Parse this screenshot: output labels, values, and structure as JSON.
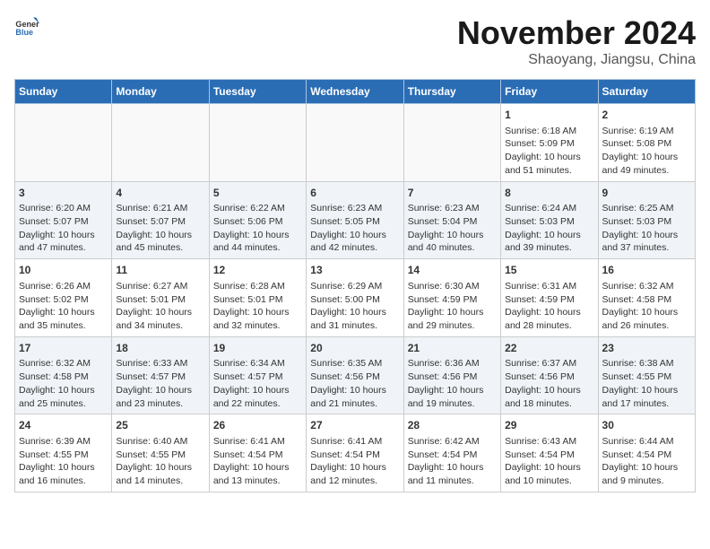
{
  "logo": {
    "line1": "General",
    "line2": "Blue"
  },
  "title": "November 2024",
  "subtitle": "Shaoyang, Jiangsu, China",
  "days_of_week": [
    "Sunday",
    "Monday",
    "Tuesday",
    "Wednesday",
    "Thursday",
    "Friday",
    "Saturday"
  ],
  "weeks": [
    [
      {
        "day": "",
        "info": ""
      },
      {
        "day": "",
        "info": ""
      },
      {
        "day": "",
        "info": ""
      },
      {
        "day": "",
        "info": ""
      },
      {
        "day": "",
        "info": ""
      },
      {
        "day": "1",
        "info": "Sunrise: 6:18 AM\nSunset: 5:09 PM\nDaylight: 10 hours and 51 minutes."
      },
      {
        "day": "2",
        "info": "Sunrise: 6:19 AM\nSunset: 5:08 PM\nDaylight: 10 hours and 49 minutes."
      }
    ],
    [
      {
        "day": "3",
        "info": "Sunrise: 6:20 AM\nSunset: 5:07 PM\nDaylight: 10 hours and 47 minutes."
      },
      {
        "day": "4",
        "info": "Sunrise: 6:21 AM\nSunset: 5:07 PM\nDaylight: 10 hours and 45 minutes."
      },
      {
        "day": "5",
        "info": "Sunrise: 6:22 AM\nSunset: 5:06 PM\nDaylight: 10 hours and 44 minutes."
      },
      {
        "day": "6",
        "info": "Sunrise: 6:23 AM\nSunset: 5:05 PM\nDaylight: 10 hours and 42 minutes."
      },
      {
        "day": "7",
        "info": "Sunrise: 6:23 AM\nSunset: 5:04 PM\nDaylight: 10 hours and 40 minutes."
      },
      {
        "day": "8",
        "info": "Sunrise: 6:24 AM\nSunset: 5:03 PM\nDaylight: 10 hours and 39 minutes."
      },
      {
        "day": "9",
        "info": "Sunrise: 6:25 AM\nSunset: 5:03 PM\nDaylight: 10 hours and 37 minutes."
      }
    ],
    [
      {
        "day": "10",
        "info": "Sunrise: 6:26 AM\nSunset: 5:02 PM\nDaylight: 10 hours and 35 minutes."
      },
      {
        "day": "11",
        "info": "Sunrise: 6:27 AM\nSunset: 5:01 PM\nDaylight: 10 hours and 34 minutes."
      },
      {
        "day": "12",
        "info": "Sunrise: 6:28 AM\nSunset: 5:01 PM\nDaylight: 10 hours and 32 minutes."
      },
      {
        "day": "13",
        "info": "Sunrise: 6:29 AM\nSunset: 5:00 PM\nDaylight: 10 hours and 31 minutes."
      },
      {
        "day": "14",
        "info": "Sunrise: 6:30 AM\nSunset: 4:59 PM\nDaylight: 10 hours and 29 minutes."
      },
      {
        "day": "15",
        "info": "Sunrise: 6:31 AM\nSunset: 4:59 PM\nDaylight: 10 hours and 28 minutes."
      },
      {
        "day": "16",
        "info": "Sunrise: 6:32 AM\nSunset: 4:58 PM\nDaylight: 10 hours and 26 minutes."
      }
    ],
    [
      {
        "day": "17",
        "info": "Sunrise: 6:32 AM\nSunset: 4:58 PM\nDaylight: 10 hours and 25 minutes."
      },
      {
        "day": "18",
        "info": "Sunrise: 6:33 AM\nSunset: 4:57 PM\nDaylight: 10 hours and 23 minutes."
      },
      {
        "day": "19",
        "info": "Sunrise: 6:34 AM\nSunset: 4:57 PM\nDaylight: 10 hours and 22 minutes."
      },
      {
        "day": "20",
        "info": "Sunrise: 6:35 AM\nSunset: 4:56 PM\nDaylight: 10 hours and 21 minutes."
      },
      {
        "day": "21",
        "info": "Sunrise: 6:36 AM\nSunset: 4:56 PM\nDaylight: 10 hours and 19 minutes."
      },
      {
        "day": "22",
        "info": "Sunrise: 6:37 AM\nSunset: 4:56 PM\nDaylight: 10 hours and 18 minutes."
      },
      {
        "day": "23",
        "info": "Sunrise: 6:38 AM\nSunset: 4:55 PM\nDaylight: 10 hours and 17 minutes."
      }
    ],
    [
      {
        "day": "24",
        "info": "Sunrise: 6:39 AM\nSunset: 4:55 PM\nDaylight: 10 hours and 16 minutes."
      },
      {
        "day": "25",
        "info": "Sunrise: 6:40 AM\nSunset: 4:55 PM\nDaylight: 10 hours and 14 minutes."
      },
      {
        "day": "26",
        "info": "Sunrise: 6:41 AM\nSunset: 4:54 PM\nDaylight: 10 hours and 13 minutes."
      },
      {
        "day": "27",
        "info": "Sunrise: 6:41 AM\nSunset: 4:54 PM\nDaylight: 10 hours and 12 minutes."
      },
      {
        "day": "28",
        "info": "Sunrise: 6:42 AM\nSunset: 4:54 PM\nDaylight: 10 hours and 11 minutes."
      },
      {
        "day": "29",
        "info": "Sunrise: 6:43 AM\nSunset: 4:54 PM\nDaylight: 10 hours and 10 minutes."
      },
      {
        "day": "30",
        "info": "Sunrise: 6:44 AM\nSunset: 4:54 PM\nDaylight: 10 hours and 9 minutes."
      }
    ]
  ]
}
